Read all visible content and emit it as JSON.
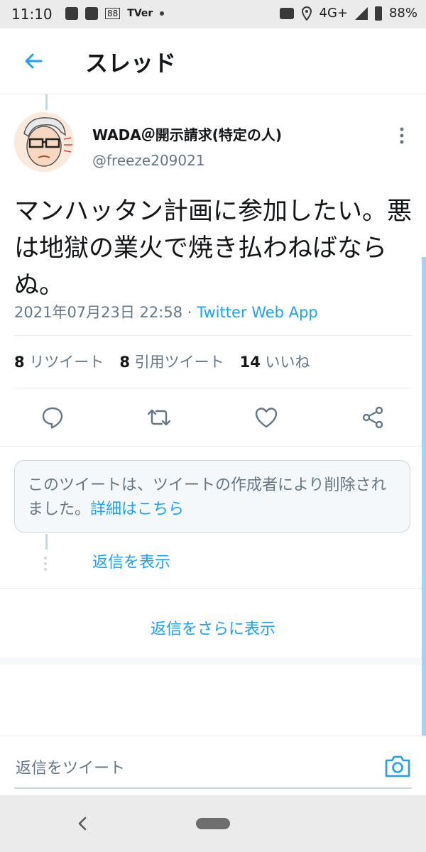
{
  "status_bar": {
    "time": "11:10",
    "network": "4G+",
    "battery": "88%",
    "box_label": "88",
    "tver_label": "TVer"
  },
  "header": {
    "title": "スレッド"
  },
  "tweet": {
    "author_name": "WADA＠開示請求(特定の人)",
    "author_handle": "@freeze209021",
    "text": "マンハッタン計画に参加したい。悪は地獄の業火で焼き払わねばならぬ。",
    "timestamp": "2021年07月23日 22:58",
    "separator": "·",
    "source": "Twitter Web App",
    "stats": {
      "retweets_count": "8",
      "retweets_label": "リツイート",
      "quotes_count": "8",
      "quotes_label": "引用ツイート",
      "likes_count": "14",
      "likes_label": "いいね"
    }
  },
  "deleted_notice": {
    "text": "このツイートは、ツイートの作成者により削除されました。",
    "link": "詳細はこちら"
  },
  "replies": {
    "show_replies": "返信を表示",
    "show_more": "返信をさらに表示"
  },
  "compose": {
    "placeholder": "返信をツイート"
  },
  "colors": {
    "accent": "#1da1f2",
    "text": "#14171a",
    "secondary": "#657786",
    "border": "#e6ecf0"
  },
  "icons": [
    "back-arrow-icon",
    "more-vertical-icon",
    "reply-icon",
    "retweet-icon",
    "like-icon",
    "share-icon",
    "camera-icon",
    "nav-back-icon"
  ]
}
